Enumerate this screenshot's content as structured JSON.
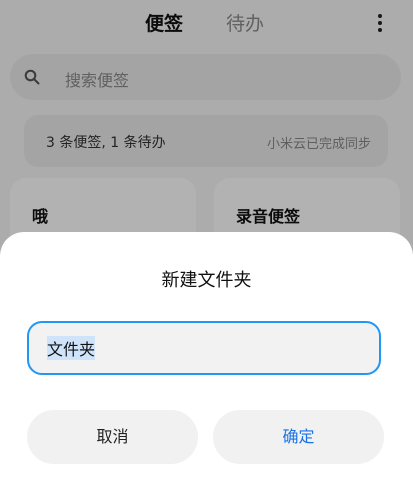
{
  "header": {
    "tabs": [
      {
        "label": "便签",
        "active": true
      },
      {
        "label": "待办",
        "active": false
      }
    ],
    "more_icon": "vertical-ellipsis"
  },
  "search": {
    "icon": "search-icon",
    "placeholder": "搜索便签"
  },
  "sync_bar": {
    "count_text": "3 条便签, 1 条待办",
    "status_text": "小米云已完成同步"
  },
  "notes": [
    {
      "title": "哦"
    },
    {
      "title": "录音便签"
    }
  ],
  "dialog": {
    "title": "新建文件夹",
    "input_value": "文件夹",
    "cancel_label": "取消",
    "confirm_label": "确定"
  },
  "colors": {
    "accent": "#1a73e8",
    "input_border": "#2196f3",
    "overlay": "rgba(0,0,0,0.30)"
  }
}
